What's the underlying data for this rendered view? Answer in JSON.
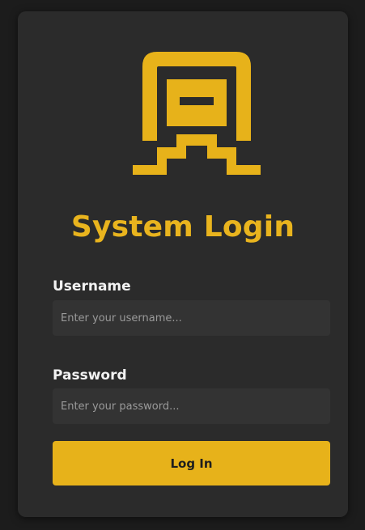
{
  "login": {
    "title": "System Login",
    "logo_icon": "terminal-logo-icon",
    "username": {
      "label": "Username",
      "placeholder": "Enter your username...",
      "value": ""
    },
    "password": {
      "label": "Password",
      "placeholder": "Enter your password...",
      "value": ""
    },
    "submit_label": "Log In"
  },
  "colors": {
    "accent": "#e7b21a",
    "card_bg": "#2b2b2b",
    "input_bg": "#333333",
    "page_bg": "#1c1c1c"
  }
}
